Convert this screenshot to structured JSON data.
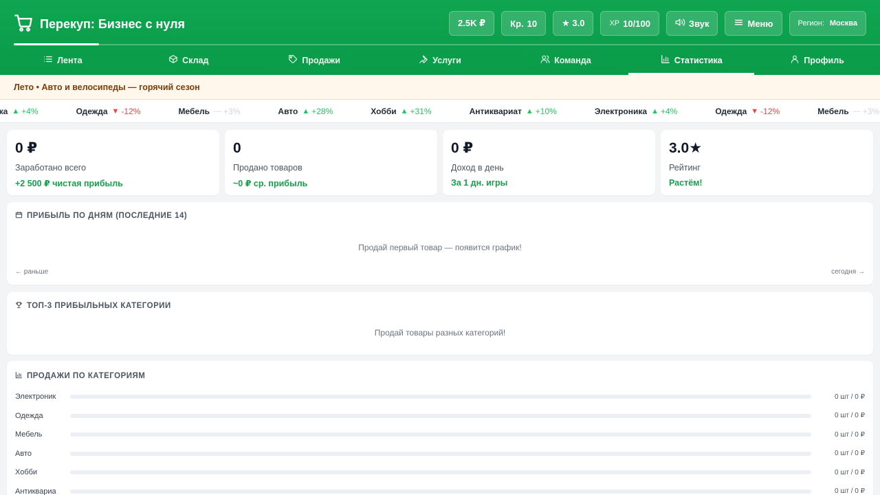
{
  "app": {
    "title": "Перекуп: Бизнес с нуля"
  },
  "hud": {
    "money": "2.5K ₽",
    "credit_prefix": "Кр.",
    "credit": "10",
    "rating": "★ 3.0",
    "xp_prefix": "XP",
    "xp": "10/100",
    "sound_label": "Звук",
    "menu_label": "Меню",
    "region_prefix": "Регион:",
    "region": "Москва"
  },
  "nav": [
    {
      "label": "Лента",
      "icon": "list-icon"
    },
    {
      "label": "Склад",
      "icon": "box-icon"
    },
    {
      "label": "Продажи",
      "icon": "tag-icon"
    },
    {
      "label": "Услуги",
      "icon": "wrench-icon"
    },
    {
      "label": "Команда",
      "icon": "team-icon"
    },
    {
      "label": "Статистика",
      "icon": "bar-chart-icon",
      "active": true
    },
    {
      "label": "Профиль",
      "icon": "user-icon"
    }
  ],
  "season": "Лето • Авто и велосипеды — горячий сезон",
  "ticker": [
    {
      "name": "ника",
      "change": "+4%",
      "dir": "up"
    },
    {
      "name": "Одежда",
      "change": "-12%",
      "dir": "down"
    },
    {
      "name": "Мебель",
      "change": "+3%",
      "dir": "flat"
    },
    {
      "name": "Авто",
      "change": "+28%",
      "dir": "up"
    },
    {
      "name": "Хобби",
      "change": "+31%",
      "dir": "up"
    },
    {
      "name": "Антиквариат",
      "change": "+10%",
      "dir": "up"
    },
    {
      "name": "Электроника",
      "change": "+4%",
      "dir": "up"
    },
    {
      "name": "Одежда",
      "change": "-12%",
      "dir": "down"
    },
    {
      "name": "Мебель",
      "change": "+3%",
      "dir": "flat"
    }
  ],
  "kpis": [
    {
      "value": "0 ₽",
      "label": "Заработано всего",
      "sub": "+2 500 ₽ чистая прибыль"
    },
    {
      "value": "0",
      "label": "Продано товаров",
      "sub": "~0 ₽ ср. прибыль"
    },
    {
      "value": "0 ₽",
      "label": "Доход в день",
      "sub": "За 1 дн. игры"
    },
    {
      "value": "3.0★",
      "label": "Рейтинг",
      "sub": "Растём!"
    }
  ],
  "daily": {
    "title": "ПРИБЫЛЬ ПО ДНЯМ (ПОСЛЕДНИЕ 14)",
    "empty": "Продай первый товар — появится график!",
    "left": "← раньше",
    "right": "сегодня →"
  },
  "top3": {
    "title": "ТОП-3 ПРИБЫЛЬНЫХ КАТЕГОРИИ",
    "empty": "Продай товары разных категорий!"
  },
  "by_category": {
    "title": "ПРОДАЖИ ПО КАТЕГОРИЯМ",
    "rows": [
      {
        "name": "Электроник",
        "value": "0 шт / 0 ₽",
        "fill": 0
      },
      {
        "name": "Одежда",
        "value": "0 шт / 0 ₽",
        "fill": 0
      },
      {
        "name": "Мебель",
        "value": "0 шт / 0 ₽",
        "fill": 0
      },
      {
        "name": "Авто",
        "value": "0 шт / 0 ₽",
        "fill": 0
      },
      {
        "name": "Хобби",
        "value": "0 шт / 0 ₽",
        "fill": 0
      },
      {
        "name": "Антиквариа",
        "value": "0 шт / 0 ₽",
        "fill": 0
      }
    ]
  },
  "colors": {
    "brand": "#0fa551",
    "accent_text": "#15a04a",
    "up": "#22c55e",
    "down": "#ef4444"
  }
}
